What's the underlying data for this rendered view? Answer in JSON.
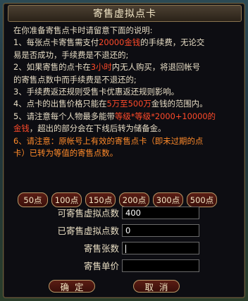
{
  "window": {
    "title": "寄售虚拟点卡",
    "close_label": "×"
  },
  "instructions": {
    "intro": "在你准备寄售点卡时请留意下面的说明:",
    "l1a": "1、每张点卡寄售需支付",
    "l1b": "20000金钱",
    "l1c": "的手续费，无论交",
    "l2": "易是否成功，手续费是不退还的;",
    "l3a": "2、如果寄售的点卡在",
    "l3b": "3小时",
    "l3c": "内无人购买，将退回帐号",
    "l4": "的寄售点数中而手续费是不退还的;",
    "l5": "3、手续费返还规则受售卡优惠返还规则影响。",
    "l6a": "4、点卡的出售价格只能在",
    "l6b": "5万至500万",
    "l6c": "金钱的范围内。",
    "l7a": "5、请注意每个人物最多能带",
    "l7b": "等级*等级*2000+10000的",
    "l8a": "金钱",
    "l8b": "，超出的部分会在下线后转为储备金。",
    "l9": "6、请注意：原帐号上有效的寄售点卡（即未过期的点",
    "l10": "卡）已转为等值的寄售点数。"
  },
  "amounts": [
    "50点",
    "100点",
    "150点",
    "200点",
    "300点",
    "500点"
  ],
  "form": {
    "available_label": "可寄售虚拟点数",
    "available_value": "400",
    "consigned_label": "已寄售虚拟点数",
    "consigned_value": "0",
    "count_label": "寄售张数",
    "count_value": "",
    "price_label": "寄售单价",
    "price_value": ""
  },
  "buttons": {
    "confirm": "确定",
    "cancel": "取消"
  }
}
